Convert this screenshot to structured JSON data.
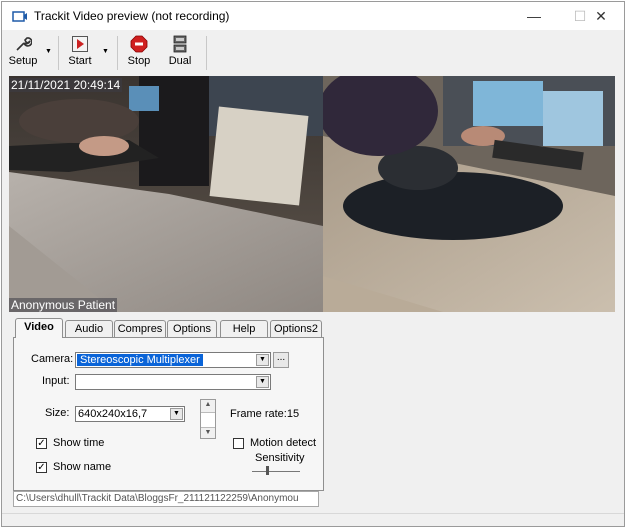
{
  "window": {
    "title": "Trackit Video preview (not recording)",
    "controls": {
      "minimize": "—",
      "maximize": "☐",
      "close": "✕"
    }
  },
  "toolbar": {
    "items": [
      {
        "label": "Setup",
        "icon": "wrench-icon"
      },
      {
        "label": "Start",
        "icon": "record-icon"
      },
      {
        "label": "Stop",
        "icon": "stop-icon"
      },
      {
        "label": "Dual",
        "icon": "dual-camera-icon"
      }
    ]
  },
  "video": {
    "timestamp": "21/11/2021 20:49:14",
    "name_overlay": "Anonymous Patient"
  },
  "tabs": [
    "Video",
    "Audio",
    "Compres",
    "Options",
    "Help",
    "Options2"
  ],
  "video_tab": {
    "camera_label": "Camera:",
    "camera_value": "Stereoscopic Multiplexer",
    "camera_browse": "...",
    "input_label": "Input:",
    "input_value": "",
    "size_label": "Size:",
    "size_value": "640x240x16,7",
    "frame_rate_label": "Frame rate:15",
    "show_time_label": "Show time",
    "show_time_checked": true,
    "show_name_label": "Show name",
    "show_name_checked": true,
    "motion_detect_label": "Motion detect",
    "motion_detect_checked": false,
    "sensitivity_label": "Sensitivity"
  },
  "path": "C:\\Users\\dhull\\Trackit Data\\BloggsFr_211121122259\\Anonymou",
  "colors": {
    "selection": "#0a64d8",
    "stop_red": "#d02020"
  }
}
